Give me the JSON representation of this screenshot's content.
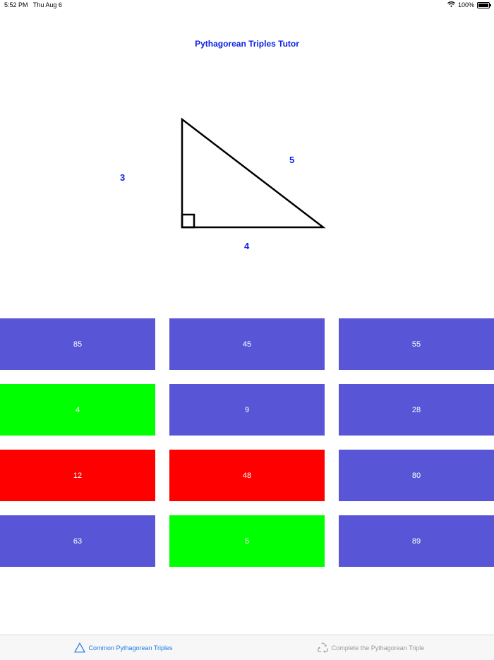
{
  "status_bar": {
    "time": "5:52 PM",
    "date": "Thu Aug 6",
    "battery_text": "100%",
    "battery_level": 1.0
  },
  "title": "Pythagorean Triples Tutor",
  "triangle": {
    "side_a": "3",
    "side_b": "4",
    "side_c": "5"
  },
  "colors": {
    "title_blue": "#0a22e6",
    "tile_default": "#5856d6",
    "tile_correct": "#00ff00",
    "tile_wrong": "#ff0000",
    "tab_active": "#1a7ce6",
    "tab_inactive": "#999999"
  },
  "tiles": [
    {
      "label": "85",
      "state": "default"
    },
    {
      "label": "45",
      "state": "default"
    },
    {
      "label": "55",
      "state": "default"
    },
    {
      "label": "4",
      "state": "correct"
    },
    {
      "label": "9",
      "state": "default"
    },
    {
      "label": "28",
      "state": "default"
    },
    {
      "label": "12",
      "state": "wrong"
    },
    {
      "label": "48",
      "state": "wrong"
    },
    {
      "label": "80",
      "state": "default"
    },
    {
      "label": "63",
      "state": "default"
    },
    {
      "label": "5",
      "state": "correct"
    },
    {
      "label": "89",
      "state": "default"
    }
  ],
  "tabs": [
    {
      "label": "Common Pythagorean Triples",
      "icon": "triangle-icon",
      "active": true
    },
    {
      "label": "Complete the Pythagorean Triple",
      "icon": "recycle-icon",
      "active": false
    }
  ]
}
